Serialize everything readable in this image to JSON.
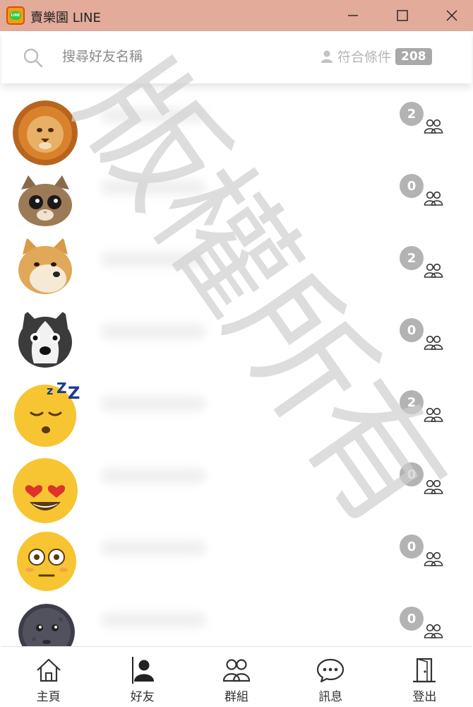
{
  "window": {
    "title": "賣樂園 LINE",
    "app_icon_text": "LINE"
  },
  "search": {
    "placeholder": "搜尋好友名稱",
    "match_label": "符合條件",
    "match_count": "208"
  },
  "friends": [
    {
      "avatar": "lion-avatar",
      "group_count": "2"
    },
    {
      "avatar": "cat-avatar",
      "group_count": "0"
    },
    {
      "avatar": "shiba-avatar",
      "group_count": "2"
    },
    {
      "avatar": "husky-avatar",
      "group_count": "0"
    },
    {
      "avatar": "sleepy-emoji-avatar",
      "group_count": "2"
    },
    {
      "avatar": "heart-eyes-emoji-avatar",
      "group_count": "0"
    },
    {
      "avatar": "flushed-emoji-avatar",
      "group_count": "0"
    },
    {
      "avatar": "moon-face-avatar",
      "group_count": "0"
    }
  ],
  "nav": {
    "home": "主頁",
    "friends": "好友",
    "groups": "群組",
    "messages": "訊息",
    "logout": "登出"
  },
  "watermark": "版權所有",
  "colors": {
    "titlebar": "#e3ab9a",
    "badge": "#b3b3b3",
    "match_count_bg": "#a9a9a9"
  }
}
